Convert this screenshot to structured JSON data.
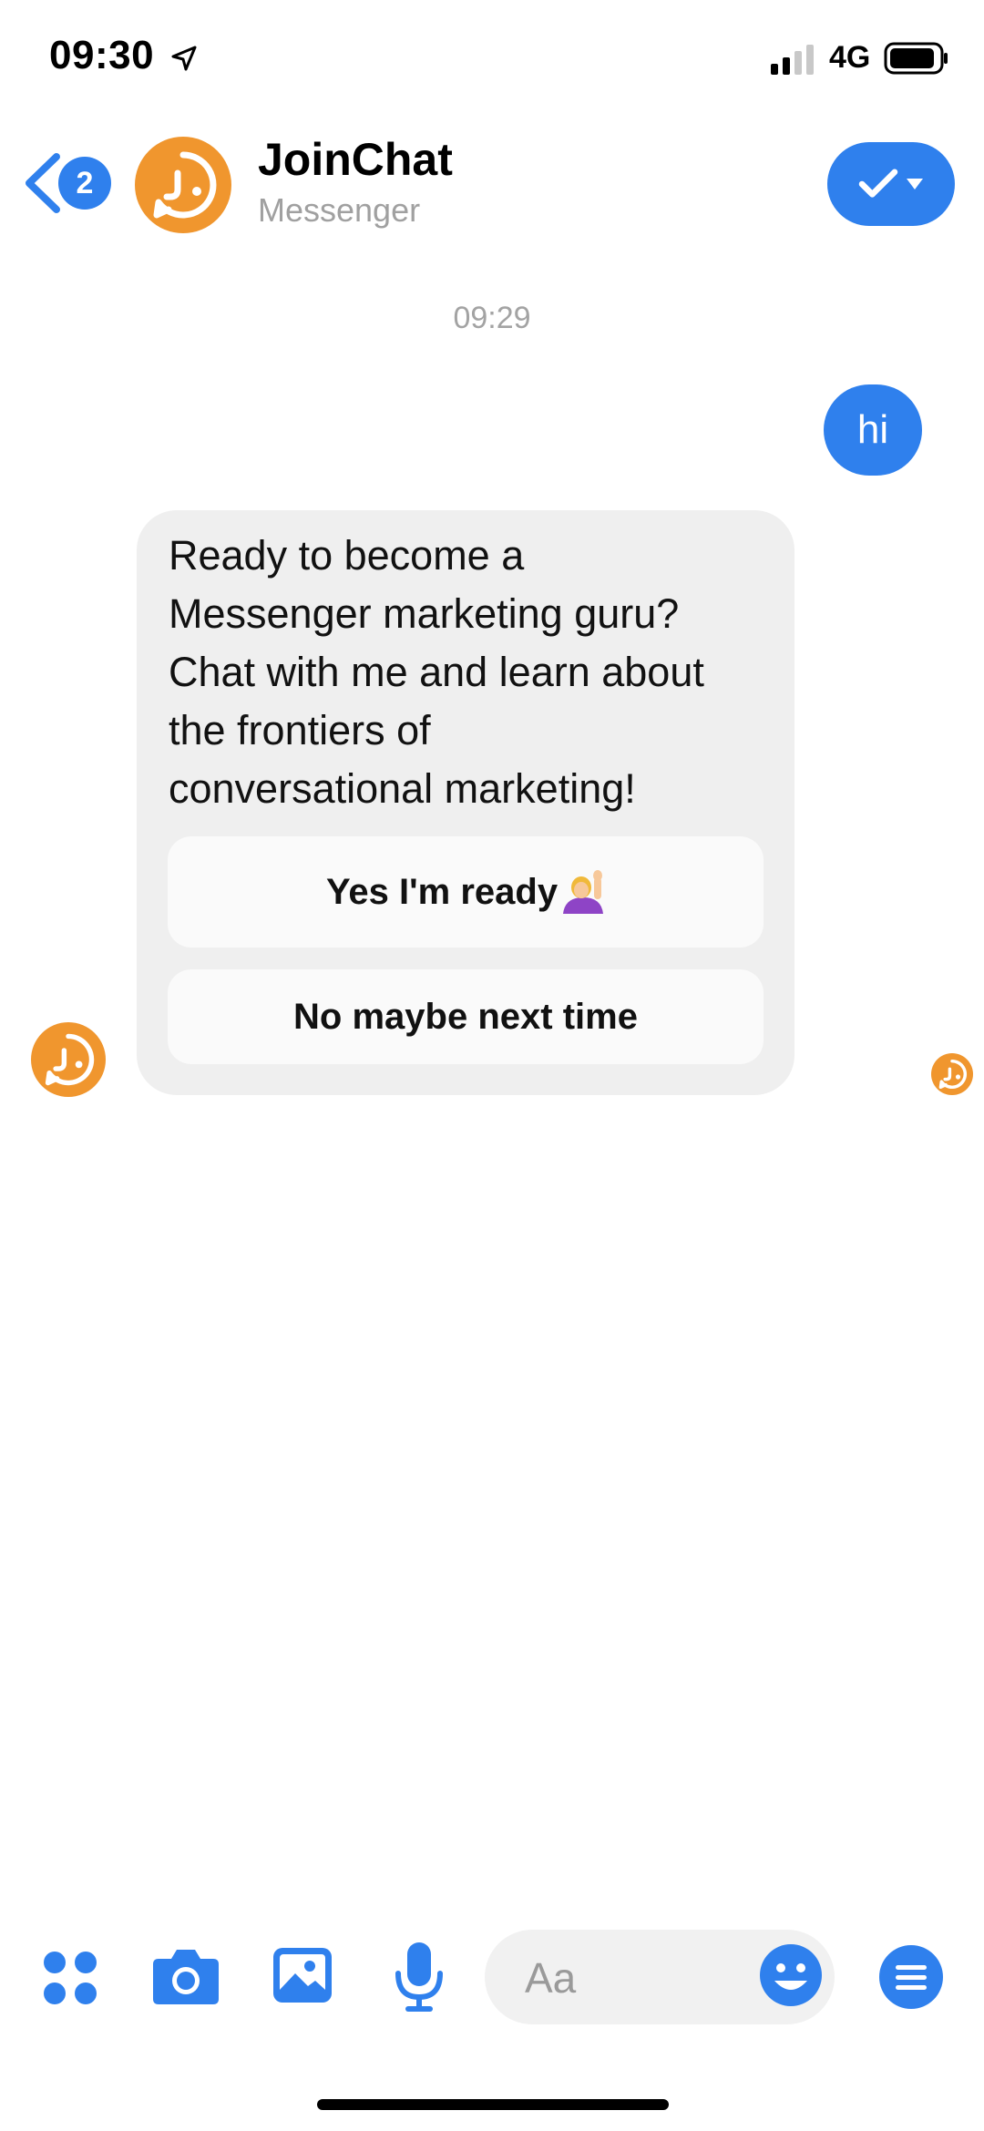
{
  "status_bar": {
    "time": "09:30",
    "network": "4G"
  },
  "header": {
    "unread_count": "2",
    "title": "JoinChat",
    "subtitle": "Messenger"
  },
  "conversation": {
    "timestamp": "09:29",
    "outgoing_message": "hi",
    "incoming_message": "Ready to become a\nMessenger marketing guru?\nChat with me and learn about\nthe frontiers of\nconversational marketing!",
    "quick_replies": [
      {
        "label": "Yes I'm ready",
        "icon": "person-raising-hand-emoji"
      },
      {
        "label": "No maybe next time"
      }
    ]
  },
  "composer": {
    "placeholder": "Aa"
  },
  "colors": {
    "accent": "#2f80ed",
    "brand": "#f0962e",
    "bubble_incoming": "#efefef",
    "quick_reply_bg": "#fafafa",
    "muted_text": "#a3a3a3"
  }
}
